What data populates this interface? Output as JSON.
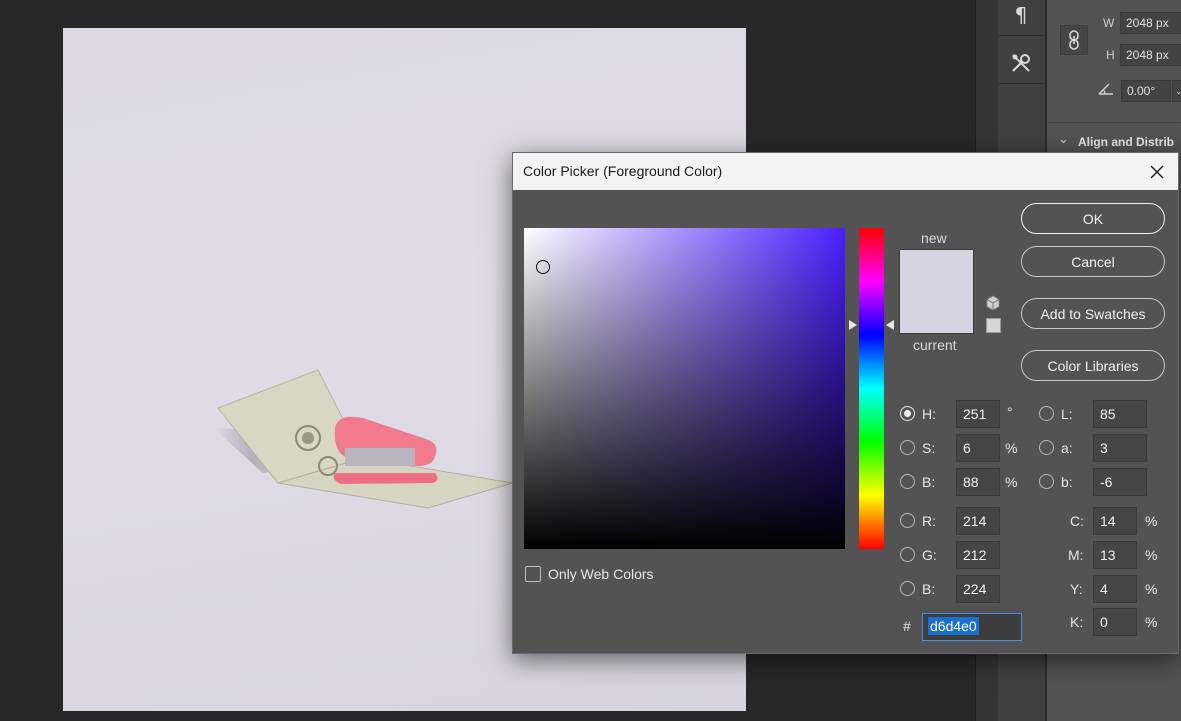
{
  "properties_panel": {
    "width_label": "W",
    "width_value": "2048 px",
    "height_label": "H",
    "height_value": "2048 px",
    "angle_value": "0.00°",
    "align_section_title": "Align and Distrib"
  },
  "dialog": {
    "title": "Color Picker (Foreground Color)",
    "buttons": {
      "ok": "OK",
      "cancel": "Cancel",
      "add_to_swatches": "Add to Swatches",
      "color_libraries": "Color Libraries"
    },
    "preview": {
      "new_label": "new",
      "current_label": "current",
      "new_color": "#d6d4e0"
    },
    "hsb": {
      "h_label": "H:",
      "h_value": "251",
      "h_unit": "°",
      "s_label": "S:",
      "s_value": "6",
      "s_unit": "%",
      "b_label": "B:",
      "b_value": "88",
      "b_unit": "%"
    },
    "lab": {
      "l_label": "L:",
      "l_value": "85",
      "a_label": "a:",
      "a_value": "3",
      "b_label": "b:",
      "b_value": "-6"
    },
    "rgb": {
      "r_label": "R:",
      "r_value": "214",
      "g_label": "G:",
      "g_value": "212",
      "b_label": "B:",
      "b_value": "224"
    },
    "cmyk": {
      "c_label": "C:",
      "c_value": "14",
      "m_label": "M:",
      "m_value": "13",
      "y_label": "Y:",
      "y_value": "4",
      "k_label": "K:",
      "k_value": "0",
      "unit": "%"
    },
    "hex": {
      "label": "#",
      "value": "d6d4e0"
    },
    "only_web_colors_label": "Only Web Colors",
    "selected_mode": "H"
  },
  "colors": {
    "canvas_bg": "#d6d4e0",
    "hue_base": "#4b1fff"
  }
}
